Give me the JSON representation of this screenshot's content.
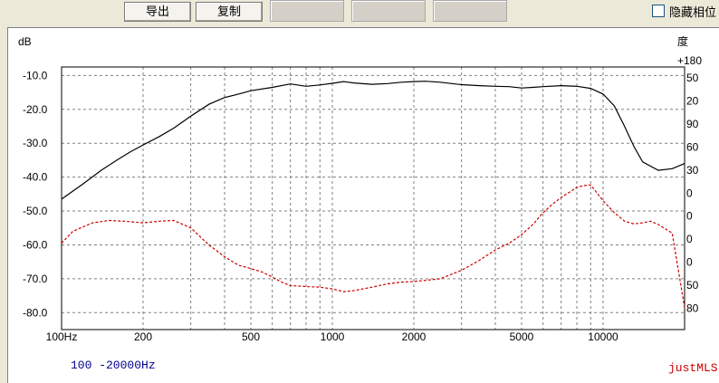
{
  "toolbar": {
    "export_label": "导出",
    "copy_label": "复制",
    "hide_phase_label": "隐藏相位"
  },
  "chart_data": {
    "type": "line",
    "x_scale": "log",
    "xlim": [
      100,
      20000
    ],
    "ylim": [
      -85,
      -7.5
    ],
    "y2lim": [
      -180,
      180
    ],
    "yunit": "dB",
    "y2unit": "度",
    "grid": true,
    "ytick_labels": [
      "-10.0",
      "-20.0",
      "-30.0",
      "-40.0",
      "-50.0",
      "-60.0",
      "-70.0",
      "-80.0"
    ],
    "ytick_values": [
      -10,
      -20,
      -30,
      -40,
      -50,
      -60,
      -70,
      -80
    ],
    "y2tick_labels": [
      "+180",
      "50",
      "20",
      "90",
      "60",
      "30",
      "0",
      "0",
      "0",
      "0",
      "50",
      "80"
    ],
    "xtick_labels": [
      "100Hz",
      "200",
      "500",
      "1000",
      "2000",
      "5000",
      "10000"
    ],
    "xtick_values": [
      100,
      200,
      500,
      1000,
      2000,
      5000,
      10000
    ],
    "range_label": "100 -20000Hz",
    "watermark": "justMLS",
    "series": [
      {
        "style": "solid",
        "color": "#000000",
        "x": [
          100,
          120,
          140,
          160,
          180,
          200,
          230,
          260,
          300,
          350,
          400,
          450,
          500,
          600,
          700,
          800,
          900,
          1000,
          1100,
          1200,
          1400,
          1600,
          1800,
          2000,
          2200,
          2500,
          3000,
          3500,
          4000,
          4500,
          5000,
          5500,
          6000,
          7000,
          8000,
          9000,
          10000,
          11000,
          12000,
          13000,
          14000,
          16000,
          18000,
          20000
        ],
        "y": [
          -46.5,
          -42,
          -38,
          -35,
          -32.5,
          -30.5,
          -28,
          -25.5,
          -22,
          -18.5,
          -16.5,
          -15.5,
          -14.5,
          -13.5,
          -12.5,
          -13.2,
          -12.8,
          -12.3,
          -11.8,
          -12.2,
          -12.6,
          -12.4,
          -12,
          -11.8,
          -11.7,
          -12,
          -12.7,
          -13,
          -13.2,
          -13.3,
          -13.7,
          -13.5,
          -13.3,
          -13,
          -13.2,
          -13.8,
          -15.5,
          -19,
          -25,
          -31,
          -35.5,
          -38,
          -37.5,
          -36
        ]
      },
      {
        "style": "dashed",
        "color": "#cc0000",
        "x": [
          100,
          110,
          130,
          150,
          170,
          200,
          230,
          260,
          300,
          350,
          400,
          450,
          500,
          550,
          600,
          650,
          700,
          800,
          900,
          1000,
          1100,
          1200,
          1400,
          1600,
          1800,
          2000,
          2200,
          2500,
          3000,
          3500,
          4000,
          4500,
          5000,
          5500,
          6000,
          6500,
          7000,
          7500,
          8000,
          8500,
          9000,
          10000,
          11000,
          12000,
          13000,
          14000,
          15000,
          16000,
          18000,
          20000
        ],
        "y": [
          -59.5,
          -56,
          -53.5,
          -52.8,
          -53,
          -53.5,
          -53,
          -52.8,
          -55,
          -60,
          -63.5,
          -66,
          -67,
          -68,
          -69.5,
          -71,
          -72,
          -72.3,
          -72.5,
          -73,
          -73.8,
          -73.5,
          -72.5,
          -71.5,
          -71,
          -70.8,
          -70.5,
          -70,
          -67.5,
          -64.5,
          -61.5,
          -59.5,
          -57,
          -54,
          -50.5,
          -48,
          -46,
          -44.5,
          -43,
          -42.5,
          -42.3,
          -47,
          -50.5,
          -53,
          -53.8,
          -53.5,
          -53,
          -54,
          -56.5,
          -78.5
        ]
      }
    ]
  }
}
